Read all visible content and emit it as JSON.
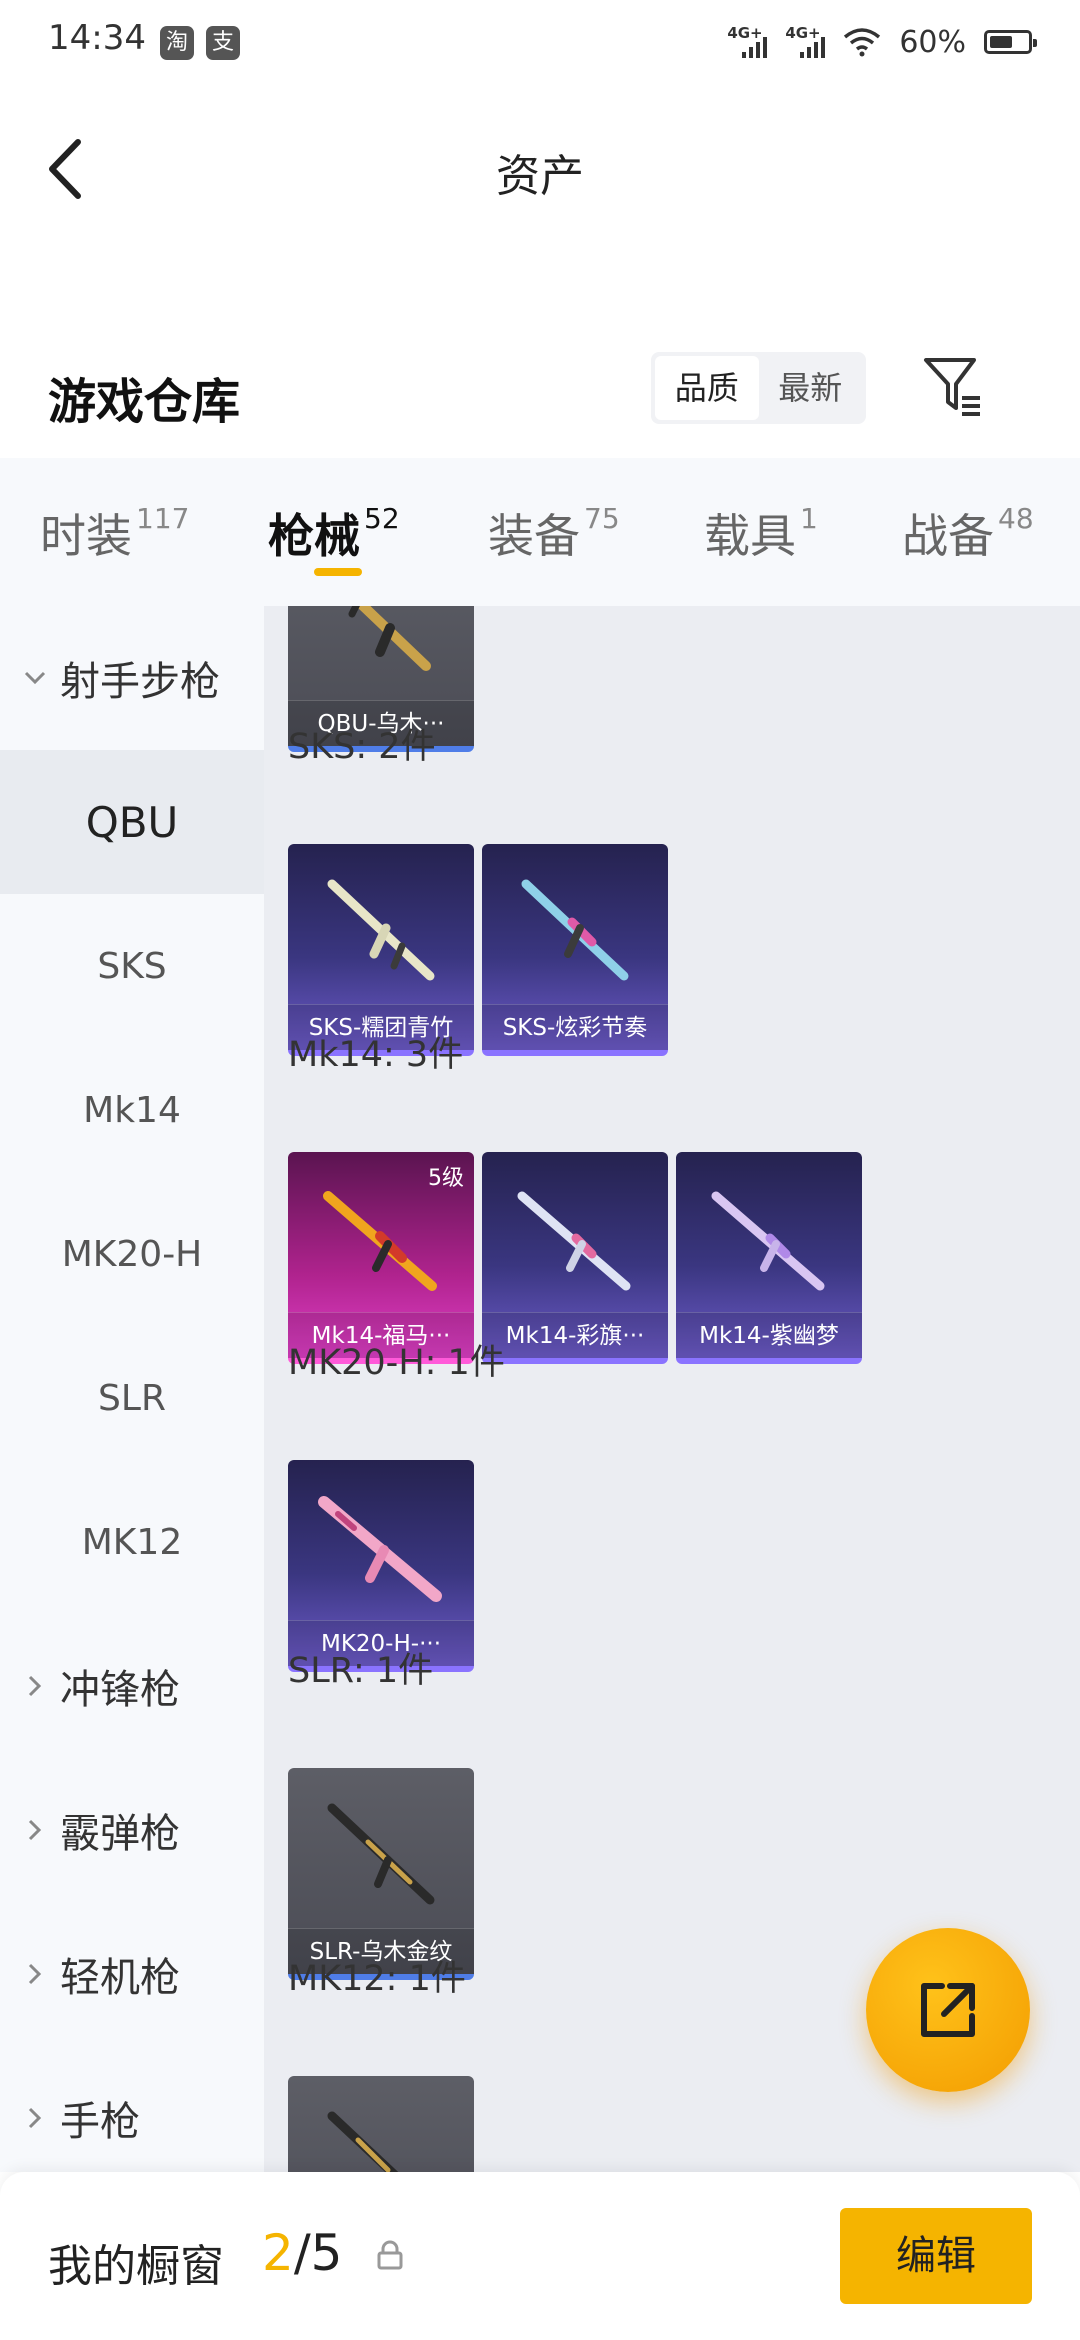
{
  "status": {
    "time": "14:34",
    "apps": [
      "淘",
      "支"
    ],
    "network_1": "4G+",
    "network_2": "4G+",
    "battery": "60%",
    "battery_level": 0.6
  },
  "header": {
    "title": "资产"
  },
  "warehouse": {
    "title": "游戏仓库",
    "sort_options": [
      "品质",
      "最新"
    ],
    "active_sort": "品质"
  },
  "tabs": [
    {
      "label": "时装",
      "count": "117"
    },
    {
      "label": "枪械",
      "count": "52"
    },
    {
      "label": "装备",
      "count": "75"
    },
    {
      "label": "载具",
      "count": "1"
    },
    {
      "label": "战备",
      "count": "48"
    }
  ],
  "active_tab": "枪械",
  "sidebar": {
    "group_1": "射手步枪",
    "sub_items": [
      "QBU",
      "SKS",
      "Mk14",
      "MK20-H",
      "SLR",
      "MK12"
    ],
    "active": "QBU",
    "group_2": "冲锋枪",
    "group_3": "霰弹枪",
    "group_4": "轻机枪",
    "group_5": "手枪"
  },
  "content": {
    "qbu_card": "QBU-乌木···",
    "sks_header": "SKS: 2件",
    "sks_cards": [
      "SKS-糯团青竹",
      "SKS-炫彩节奏"
    ],
    "mk14_header": "Mk14: 3件",
    "mk14_cards": [
      "Mk14-福马···",
      "Mk14-彩旗···",
      "Mk14-紫幽梦"
    ],
    "mk14_level": "5级",
    "mk20_header": "MK20-H: 1件",
    "mk20_cards": [
      "MK20-H-···"
    ],
    "slr_header": "SLR: 1件",
    "slr_cards": [
      "SLR-乌木金纹"
    ],
    "mk12_header": "MK12: 1件"
  },
  "bottom": {
    "showcase_label": "我的橱窗",
    "current": "2",
    "separator": "/",
    "total": "5",
    "edit_label": "编辑"
  },
  "colors": {
    "accent": "#f5b400",
    "tier_grey_border": "#4f7de8",
    "tier_purple": "#3a3680",
    "tier_pink": "#e040c8"
  },
  "icons": [
    "back-icon",
    "filter-icon",
    "chevron-down-icon",
    "chevron-right-icon",
    "share-icon",
    "lock-icon"
  ]
}
